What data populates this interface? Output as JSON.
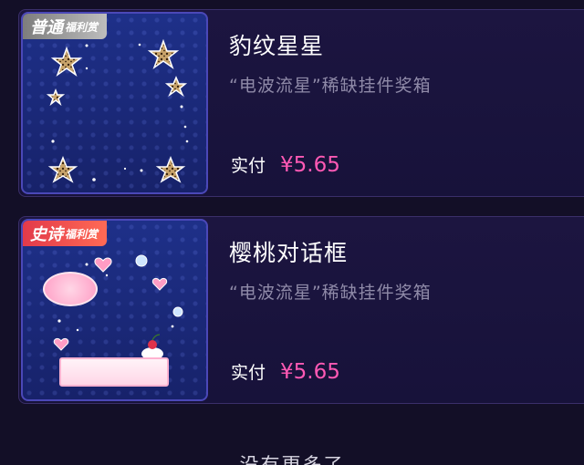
{
  "items": [
    {
      "badge_main": "普通",
      "badge_sub": "福利赏",
      "title": "豹纹星星",
      "subtitle": "“电波流星”稀缺挂件奖箱",
      "price_label": "实付",
      "price_value": "¥5.65"
    },
    {
      "badge_main": "史诗",
      "badge_sub": "福利赏",
      "title": "樱桃对话框",
      "subtitle": "“电波流星”稀缺挂件奖箱",
      "price_label": "实付",
      "price_value": "¥5.65"
    }
  ],
  "footer": {
    "text": "没有更多了"
  },
  "colors": {
    "background": "#130f27",
    "price": "#ff59b4",
    "card_border": "#3a2f6a",
    "thumb_border": "#4b48b8"
  }
}
